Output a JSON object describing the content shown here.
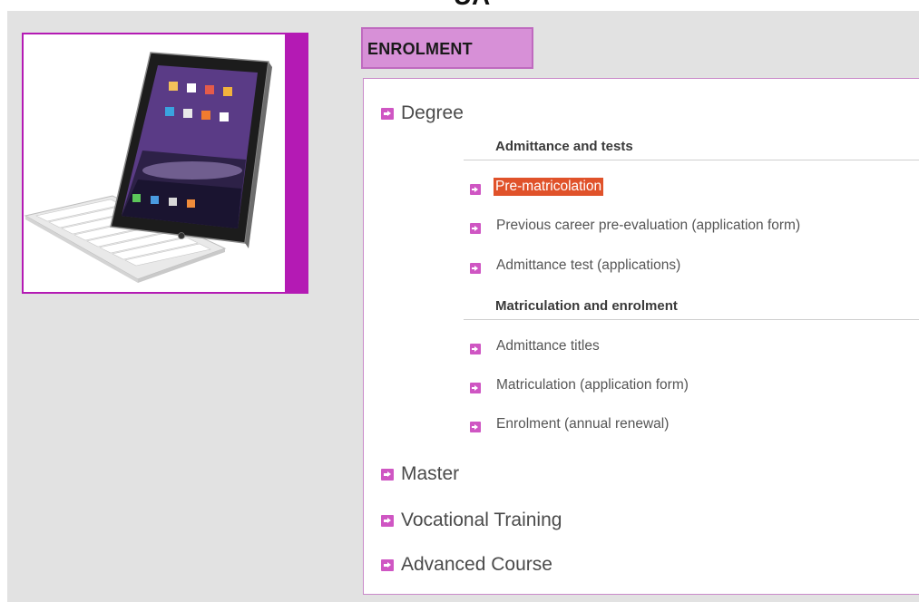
{
  "page": {
    "top_title_cut": "UA",
    "accent_color": "#b41ab4",
    "tab_color": "#d790d7",
    "selected_color": "#e0522a"
  },
  "product_image": {
    "description_icon": "tablet-keyboard-icon"
  },
  "enrolment": {
    "tab_label": "ENROLMENT",
    "menu": {
      "degree": {
        "label": "Degree",
        "sections": [
          {
            "heading": "Admittance and tests",
            "items": [
              {
                "label": "Pre-matricolation",
                "selected": true
              },
              {
                "label": "Previous career pre-evaluation (application form)"
              },
              {
                "label": "Admittance test (applications)"
              }
            ]
          },
          {
            "heading": "Matriculation and enrolment",
            "items": [
              {
                "label": "Admittance titles"
              },
              {
                "label": "Matriculation (application form)"
              },
              {
                "label": "Enrolment (annual renewal)"
              }
            ]
          }
        ]
      },
      "others": [
        {
          "label": "Master"
        },
        {
          "label": "Vocational Training"
        },
        {
          "label": "Advanced Course"
        }
      ]
    }
  }
}
